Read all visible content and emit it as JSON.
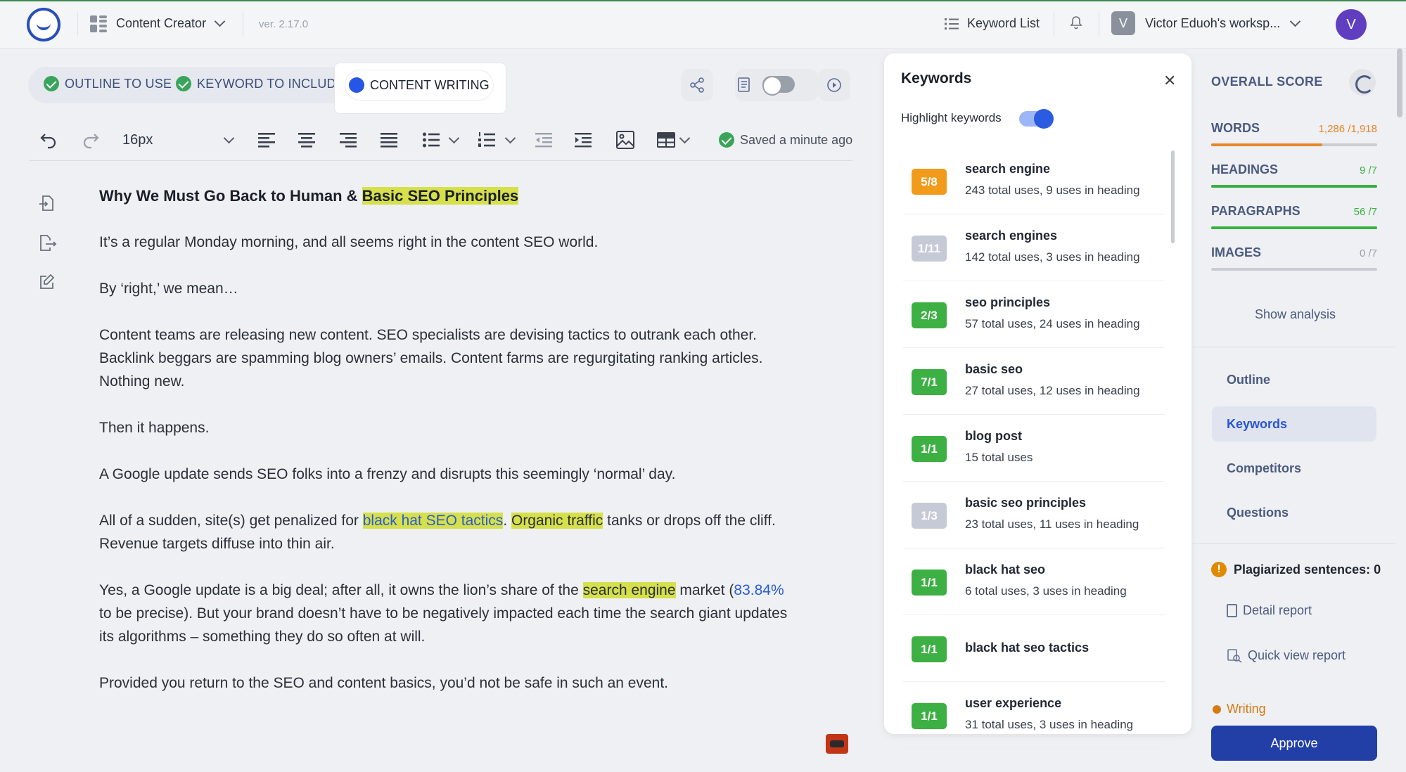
{
  "topbar": {
    "app_mode": "Content Creator",
    "version": "ver. 2.17.0",
    "keyword_list": "Keyword List",
    "workspace": "Victor Eduoh's worksp...",
    "workspace_initial": "V",
    "avatar_initial": "V"
  },
  "steps": [
    {
      "label": "OUTLINE TO USE",
      "state": "done"
    },
    {
      "label": "KEYWORD TO INCLUDE",
      "state": "done"
    },
    {
      "label": "CONTENT WRITING",
      "state": "active"
    }
  ],
  "toolbar": {
    "font_size": "16px",
    "saved_status": "Saved a minute ago"
  },
  "document": {
    "title_plain": "Why We Must Go Back to Human & ",
    "title_highlight": "Basic SEO Principles",
    "p1": "It’s a regular Monday morning, and all seems right in the content SEO world.",
    "p2": "By ‘right,’ we mean…",
    "p3": "Content teams are releasing new content. SEO specialists are devising tactics to outrank each other. Backlink beggars are spamming blog owners’ emails. Content farms are regurgitating ranking articles. Nothing new.",
    "p4": "Then it happens.",
    "p5": "A Google update sends SEO folks into a frenzy and disrupts this seemingly ‘normal’ day.",
    "p6_a": "All of a sudden, site(s) get penalized for ",
    "p6_link1": "black hat SEO tactics",
    "p6_b": ". ",
    "p6_hl": "Organic traffic",
    "p6_c": " tanks or drops off the cliff. Revenue targets diffuse into thin air.",
    "p7_a": "Yes, a Google update is a big deal; after all, it owns the lion’s share of the ",
    "p7_hl": "search engine",
    "p7_b": " market (",
    "p7_link": "83.84%",
    "p7_c": " to be precise). But your brand doesn’t have to be negatively impacted each time the search giant updates its algorithms – something they do so often at will.",
    "p8": "Provided you return to the SEO and content basics, you’d not be safe in such an event."
  },
  "keywords_panel": {
    "title": "Keywords",
    "highlight_label": "Highlight keywords",
    "highlight_on": true,
    "items": [
      {
        "badge": "5/8",
        "color": "#f29a1a",
        "name": "search engine",
        "usage": "243 total uses, 9 uses in heading"
      },
      {
        "badge": "1/11",
        "color": "#c6cad6",
        "name": "search engines",
        "usage": "142 total uses, 3 uses in heading"
      },
      {
        "badge": "2/3",
        "color": "#3cb043",
        "name": "seo principles",
        "usage": "57 total uses, 24 uses in heading"
      },
      {
        "badge": "7/1",
        "color": "#3cb043",
        "name": "basic seo",
        "usage": "27 total uses, 12 uses in heading"
      },
      {
        "badge": "1/1",
        "color": "#3cb043",
        "name": "blog post",
        "usage": "15 total uses"
      },
      {
        "badge": "1/3",
        "color": "#c6cad6",
        "name": "basic seo principles",
        "usage": "23 total uses, 11 uses in heading"
      },
      {
        "badge": "1/1",
        "color": "#3cb043",
        "name": "black hat seo",
        "usage": "6 total uses, 3 uses in heading"
      },
      {
        "badge": "1/1",
        "color": "#3cb043",
        "name": "black hat seo tactics",
        "usage": ""
      },
      {
        "badge": "1/1",
        "color": "#3cb043",
        "name": "user experience",
        "usage": "31 total uses, 3 uses in heading"
      }
    ]
  },
  "score": {
    "title": "OVERALL SCORE",
    "metrics": [
      {
        "label": "WORDS",
        "value": "1,286 /1,918",
        "progress": 0.67,
        "color": "#e8862a"
      },
      {
        "label": "HEADINGS",
        "value": "9 /7",
        "progress": 1.0,
        "color": "#3cb043"
      },
      {
        "label": "PARAGRAPHS",
        "value": "56 /7",
        "progress": 1.0,
        "color": "#3cb043"
      },
      {
        "label": "IMAGES",
        "value": "0 /7",
        "progress": 0.0,
        "color": "#9aa0aa"
      }
    ],
    "show_analysis": "Show analysis"
  },
  "nav": {
    "items": [
      "Outline",
      "Keywords",
      "Competitors",
      "Questions"
    ],
    "active": "Keywords"
  },
  "plagiarism": {
    "label": "Plagiarized sentences: 0",
    "detail": "Detail report",
    "quick": "Quick view report"
  },
  "status": {
    "label": "Writing",
    "approve": "Approve"
  }
}
